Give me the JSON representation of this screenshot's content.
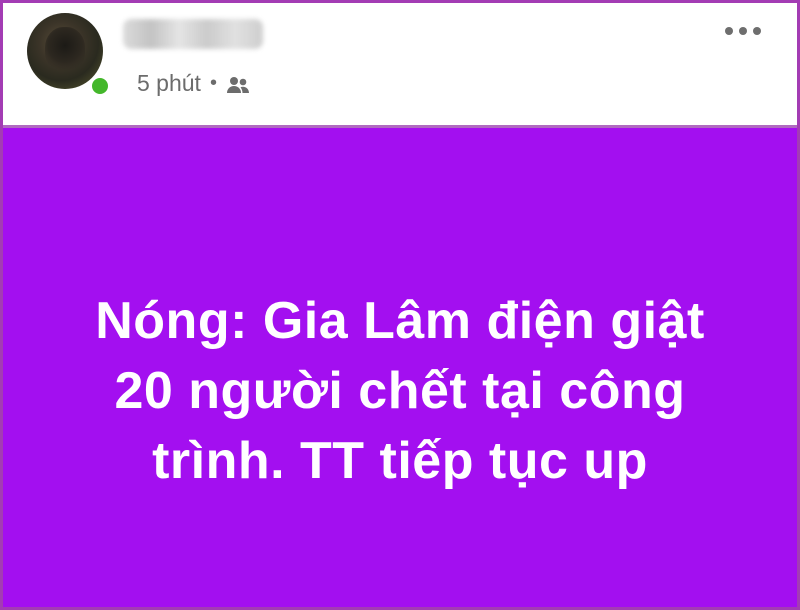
{
  "post": {
    "header": {
      "author_name": "",
      "timestamp": "5 phút",
      "separator": "•",
      "audience_icon": "friends-icon",
      "menu_icon": "more-options-icon",
      "online_status_color": "#44b72b"
    },
    "body": {
      "text": "Nóng: Gia Lâm điện giật 20 người chết tại công trình. TT tiếp tục up",
      "background_color": "#a30ff0",
      "text_color": "#ffffff"
    }
  }
}
